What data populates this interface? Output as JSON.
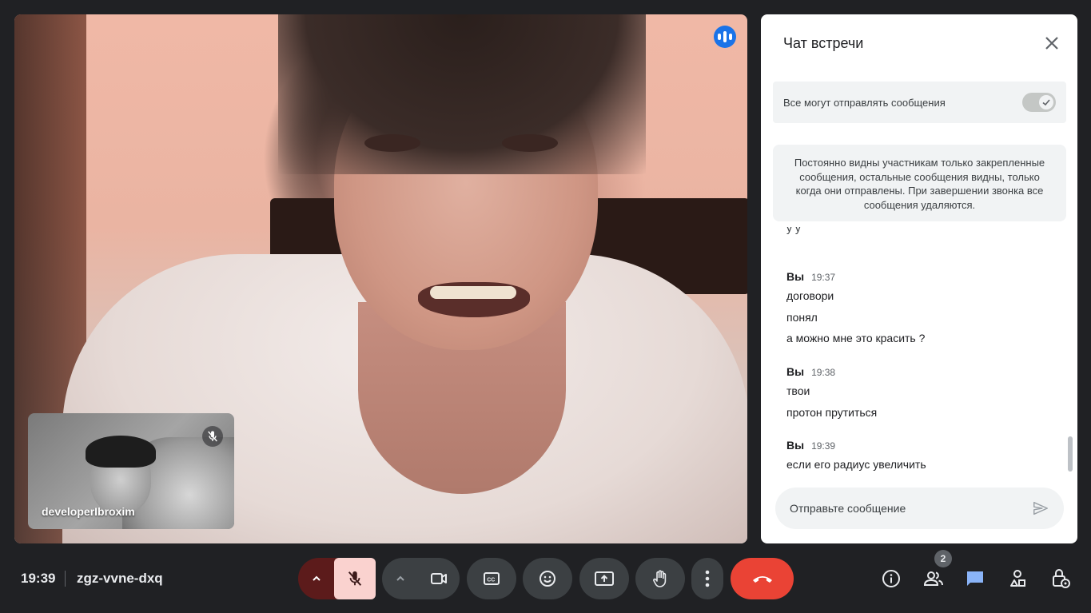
{
  "meeting": {
    "time": "19:39",
    "code": "zgz-vvne-dxq",
    "participants_count": "2"
  },
  "self_view": {
    "name": "developerIbroxim"
  },
  "chat": {
    "title": "Чат встречи",
    "allow_label": "Все могут отправлять сообщения",
    "allow_enabled": true,
    "info": "Постоянно видны участникам только закрепленные сообщения, остальные сообщения видны, только когда они отправлены. При завершении звонка все сообщения удаляются.",
    "clipped_text": "у у",
    "groups": [
      {
        "sender": "Вы",
        "time": "19:37",
        "messages": [
          "договори",
          "понял",
          "а можно мне это красить ?"
        ]
      },
      {
        "sender": "Вы",
        "time": "19:38",
        "messages": [
          "твои",
          "протон прутиться"
        ]
      },
      {
        "sender": "Вы",
        "time": "19:39",
        "messages": [
          "если его радиус увеличить"
        ]
      }
    ],
    "input_placeholder": "Отправьте сообщение"
  },
  "colors": {
    "background": "#202124",
    "accent": "#1a73e8",
    "end_call": "#ea4335",
    "mic_muted_bg": "#fad2cf",
    "mic_muted_pill": "#5c1b1b"
  },
  "icons": {
    "controls": [
      "chevron-up-icon",
      "mic-off-icon",
      "videocam-icon",
      "closed-captions-icon",
      "emoji-icon",
      "present-screen-icon",
      "raise-hand-icon",
      "more-vert-icon",
      "call-end-icon"
    ],
    "right": [
      "info-icon",
      "people-icon",
      "chat-icon",
      "activities-icon",
      "host-controls-icon"
    ]
  }
}
